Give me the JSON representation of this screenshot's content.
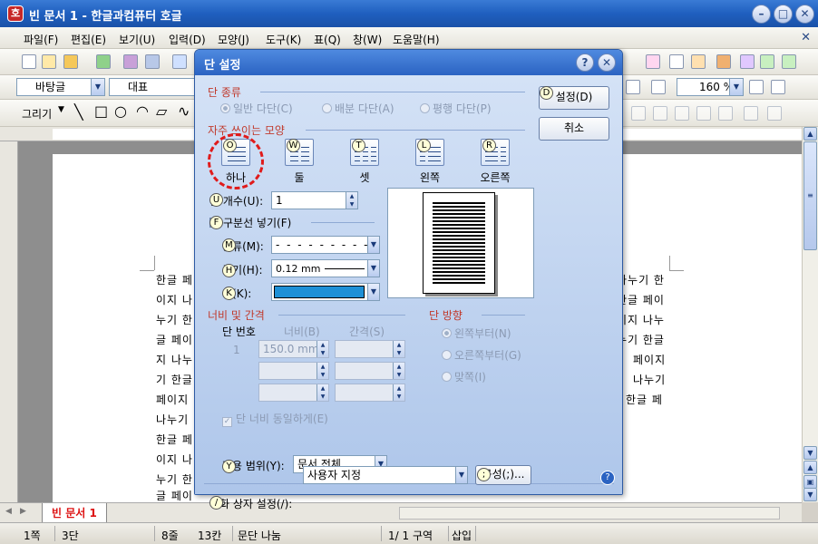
{
  "window": {
    "title": "빈 문서 1 - 한글과컴퓨터 호글",
    "app_icon": "호"
  },
  "menu": [
    "파일(F)",
    "편집(E)",
    "보기(U)",
    "입력(D)",
    "모양(J)",
    "도구(K)",
    "표(Q)",
    "창(W)",
    "도움말(H)"
  ],
  "toolbar": {
    "style_value": "바탕글",
    "font_value": "대표",
    "zoom_value": "160 %",
    "draw_label": "그리기"
  },
  "document": {
    "lines": [
      "한글 페",
      "이지 나",
      "누기 한",
      "글 페이",
      "지 나누",
      "기 한글",
      "페이지",
      "나누기",
      "한글 페",
      "이지 나",
      "누기 한",
      "글 페이"
    ],
    "lines_right": [
      "나누기 한",
      "한글 페이",
      "이지 나누",
      "누기 한글",
      "페이지",
      "나누기",
      "한글 페"
    ],
    "tab_label": "빈 문서 1"
  },
  "status": {
    "page": "1쪽",
    "section": "3단",
    "line": "8줄",
    "column": "13칸",
    "info": "문단 나눔",
    "pages": "1/ 1 구역",
    "mode": "삽입"
  },
  "dialog": {
    "title": "단 설정",
    "type_section": "단 종류",
    "type_options": [
      "일반 다단(C)",
      "배분 다단(A)",
      "평행 다단(P)"
    ],
    "preset_section": "자주 쓰이는 모양",
    "presets": [
      {
        "label": "하나",
        "hint": "O"
      },
      {
        "label": "둘",
        "hint": "W"
      },
      {
        "label": "셋",
        "hint": "T"
      },
      {
        "label": "왼쪽",
        "hint": "L"
      },
      {
        "label": "오른쪽",
        "hint": "R"
      }
    ],
    "count_label": "단 개수(U):",
    "count_value": "1",
    "divider_label": "구분선 넣기(F)",
    "kind_label": "종류(M):",
    "width_label": "굵기(H):",
    "width_value": "0.12 mm",
    "color_label": "색(K):",
    "line_color": "#1e90d6",
    "size_section": "너비 및 간격",
    "col_number_label": "단 번호",
    "col_width_label": "너비(B)",
    "col_gap_label": "간격(S)",
    "row1_number": "1",
    "row1_width": "150.0 mm",
    "equal_width_label": "단 너비 동일하게(E)",
    "direction_section": "단 방향",
    "direction_options": [
      "왼쪽부터(N)",
      "오른쪽부터(G)",
      "맞쪽(I)"
    ],
    "apply_label": "적용 범위(Y):",
    "apply_value": "문서 전체",
    "dialog_settings_label": "대화 상자 설정(/):",
    "dialog_settings_value": "사용자 지정",
    "compose_button": "구성(;)...",
    "ok_button": "설정(D)",
    "cancel_button": "취소",
    "hints": {
      "ok": "D",
      "count": "U",
      "divider": "F",
      "kind": "M",
      "width": "H",
      "color": "K",
      "apply": "Y",
      "settings": "/",
      "compose": ";"
    }
  }
}
